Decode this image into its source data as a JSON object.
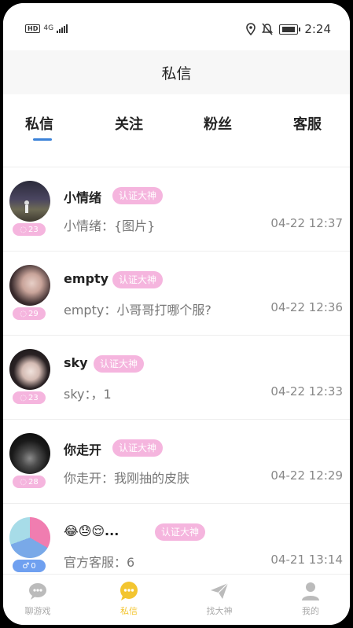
{
  "status_bar": {
    "left_labels": [
      "HD",
      "4G"
    ],
    "time": "2:24"
  },
  "header": {
    "title": "私信"
  },
  "tabs": [
    {
      "label": "私信",
      "active": true
    },
    {
      "label": "关注",
      "active": false
    },
    {
      "label": "粉丝",
      "active": false
    },
    {
      "label": "客服",
      "active": false
    }
  ],
  "messages": [
    {
      "name": "小情绪",
      "badge": "认证大神",
      "preview": "小情绪：{图片}",
      "time": "04-22 12:37",
      "count": "23"
    },
    {
      "name": "empty",
      "badge": "认证大神",
      "preview": "empty：小哥哥打哪个服?",
      "time": "04-22 12:36",
      "count": "29"
    },
    {
      "name": "sky",
      "badge": "认证大神",
      "preview": "sky：，1",
      "time": "04-22 12:33",
      "count": "23"
    },
    {
      "name": "你走开",
      "badge": "认证大神",
      "preview": "你走开：我刚抽的皮肤",
      "time": "04-22 12:29",
      "count": "28"
    },
    {
      "name": "😂😓😌...",
      "badge": "认证大神",
      "preview": "官方客服：6",
      "time": "04-21 13:14",
      "count": "0"
    }
  ],
  "bottom_nav": [
    {
      "label": "聊游戏",
      "icon": "chat-game-icon",
      "active": false
    },
    {
      "label": "私信",
      "icon": "message-icon",
      "active": true
    },
    {
      "label": "找大神",
      "icon": "paper-plane-icon",
      "active": false
    },
    {
      "label": "我的",
      "icon": "person-icon",
      "active": false
    }
  ],
  "colors": {
    "accent": "#3b82d8",
    "badge_pink": "#f5b5de",
    "active_nav": "#f3c530"
  }
}
